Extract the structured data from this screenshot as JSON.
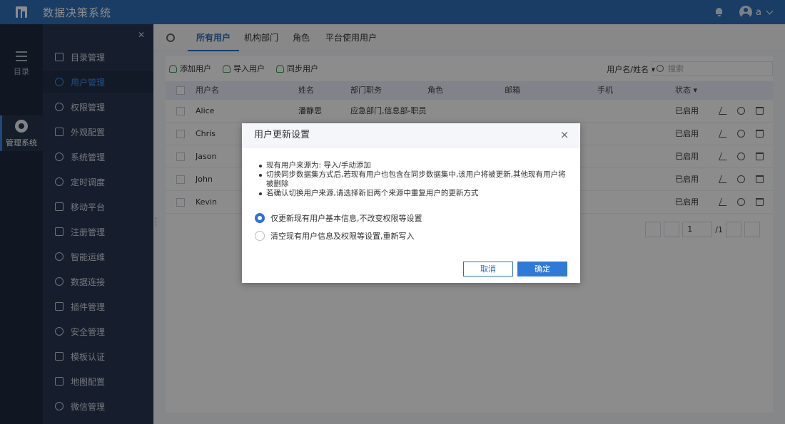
{
  "app": {
    "title": "数据决策系统",
    "user": "a"
  },
  "rail": [
    {
      "label": "目录"
    },
    {
      "label": "管理系统"
    }
  ],
  "sidebar": {
    "items": [
      {
        "label": "目录管理"
      },
      {
        "label": "用户管理",
        "active": true
      },
      {
        "label": "权限管理"
      },
      {
        "label": "外观配置"
      },
      {
        "label": "系统管理"
      },
      {
        "label": "定时调度"
      },
      {
        "label": "移动平台"
      },
      {
        "label": "注册管理"
      },
      {
        "label": "智能运维"
      },
      {
        "label": "数据连接"
      },
      {
        "label": "插件管理"
      },
      {
        "label": "安全管理"
      },
      {
        "label": "模板认证"
      },
      {
        "label": "地图配置"
      },
      {
        "label": "微信管理"
      }
    ]
  },
  "tabs": [
    "所有用户",
    "机构部门",
    "角色",
    "平台使用用户"
  ],
  "toolbar": {
    "add": "添加用户",
    "import": "导入用户",
    "sync": "同步用户",
    "filter": "用户名/姓名",
    "search_placeholder": "搜索"
  },
  "table": {
    "columns": [
      "用户名",
      "姓名",
      "部门职务",
      "角色",
      "邮箱",
      "手机",
      "状态"
    ],
    "rows": [
      {
        "username": "Alice",
        "name": "潘静思",
        "dept": "应急部门,信息部-职员",
        "status": "已启用"
      },
      {
        "username": "Chris",
        "name": "",
        "dept": "",
        "status": "已启用"
      },
      {
        "username": "Jason",
        "name": "",
        "dept": "",
        "status": "已启用"
      },
      {
        "username": "John",
        "name": "",
        "dept": "",
        "status": "已启用"
      },
      {
        "username": "Kevin",
        "name": "",
        "dept": "",
        "status": "已启用"
      }
    ]
  },
  "pager": {
    "page": "1",
    "total": "/1"
  },
  "modal": {
    "title": "用户更新设置",
    "close": "×",
    "notes": [
      "现有用户来源为: 导入/手动添加",
      "切换同步数据集方式后,若现有用户也包含在同步数据集中,该用户将被更新,其他现有用户将被删除",
      "若确认切换用户来源,请选择新旧两个来源中重复用户的更新方式"
    ],
    "options": [
      {
        "label": "仅更新现有用户基本信息,不改变权限等设置",
        "selected": true
      },
      {
        "label": "清空现有用户信息及权限等设置,重新写入",
        "selected": false
      }
    ],
    "cancel": "取消",
    "confirm": "确定"
  },
  "colors": {
    "topbar": "#2e6fb7",
    "sidebar": "#283754",
    "rail": "#1f2b3e",
    "accent": "#2f7ad9"
  }
}
